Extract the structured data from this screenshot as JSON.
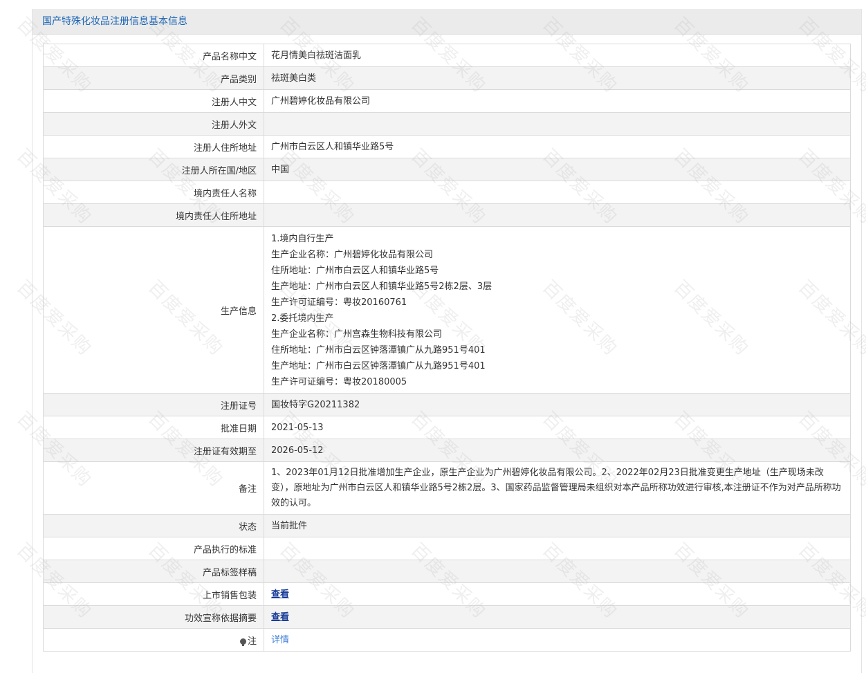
{
  "panel": {
    "title": "国产特殊化妆品注册信息基本信息"
  },
  "rows": [
    {
      "label": "产品名称中文",
      "value": "花月情美白祛斑洁面乳"
    },
    {
      "label": "产品类别",
      "value": "祛斑美白类"
    },
    {
      "label": "注册人中文",
      "value": "广州碧婷化妆品有限公司"
    },
    {
      "label": "注册人外文",
      "value": ""
    },
    {
      "label": "注册人住所地址",
      "value": "广州市白云区人和镇华业路5号"
    },
    {
      "label": "注册人所在国/地区",
      "value": "中国"
    },
    {
      "label": "境内责任人名称",
      "value": ""
    },
    {
      "label": "境内责任人住所地址",
      "value": ""
    }
  ],
  "production": {
    "label": "生产信息",
    "lines": [
      "1.境内自行生产",
      "生产企业名称：广州碧婷化妆品有限公司",
      "住所地址：广州市白云区人和镇华业路5号",
      "生产地址：广州市白云区人和镇华业路5号2栋2层、3层",
      "生产许可证编号：粤妆20160761",
      "2.委托境内生产",
      "生产企业名称：广州宫森生物科技有限公司",
      "住所地址：广州市白云区钟落潭镇广从九路951号401",
      "生产地址：广州市白云区钟落潭镇广从九路951号401",
      "生产许可证编号：粤妆20180005"
    ]
  },
  "rows2": [
    {
      "label": "注册证号",
      "value": "国妆特字G20211382"
    },
    {
      "label": "批准日期",
      "value": "2021-05-13"
    },
    {
      "label": "注册证有效期至",
      "value": "2026-05-12"
    }
  ],
  "remark": {
    "label": "备注",
    "value": "1、2023年01月12日批准增加生产企业，原生产企业为广州碧婷化妆品有限公司。2、2022年02月23日批准变更生产地址（生产现场未改变），原地址为广州市白云区人和镇华业路5号2栋2层。3、国家药品监督管理局未组织对本产品所称功效进行审核,本注册证不作为对产品所称功效的认可。"
  },
  "rows3": [
    {
      "label": "状态",
      "value": "当前批件"
    },
    {
      "label": "产品执行的标准",
      "value": ""
    },
    {
      "label": "产品标签样稿",
      "value": ""
    }
  ],
  "link_rows": [
    {
      "label": "上市销售包装",
      "link": "查看"
    },
    {
      "label": "功效宣称依据摘要",
      "link": "查看"
    }
  ],
  "note_row": {
    "label": "注",
    "link": "详情",
    "icon": "lightbulb-icon"
  },
  "watermark": {
    "text": "百度爱采购"
  }
}
